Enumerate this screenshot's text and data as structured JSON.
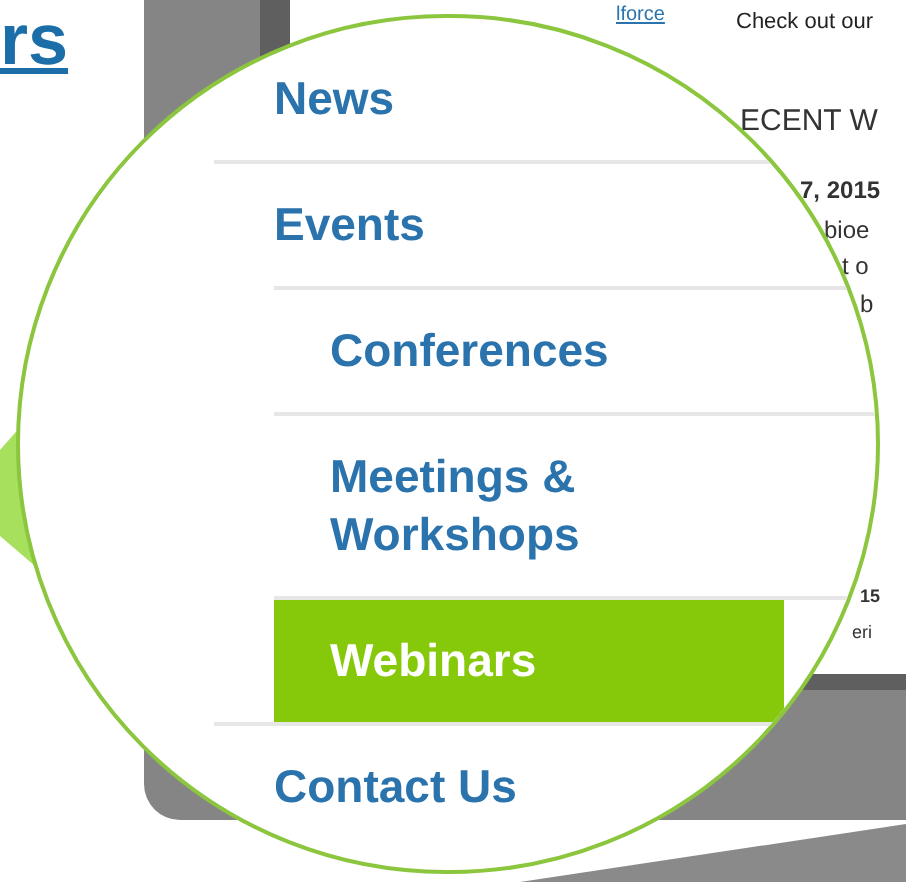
{
  "heading": {
    "text": "rs"
  },
  "page": {
    "link": "lforce",
    "intro": "Check out our",
    "section_title": "ECENT W",
    "fragments": [
      "7, 2015",
      "bioe",
      "t o",
      "b",
      "15",
      "eri"
    ]
  },
  "magnifier": {
    "menu": [
      {
        "label": "News",
        "selected": false
      },
      {
        "label": "Events",
        "selected": false,
        "children": [
          {
            "label": "Conferences",
            "selected": false
          },
          {
            "label": "Meetings & Workshops",
            "selected": false
          },
          {
            "label": "Webinars",
            "selected": true
          }
        ]
      },
      {
        "label": "Contact Us",
        "selected": false
      }
    ]
  }
}
